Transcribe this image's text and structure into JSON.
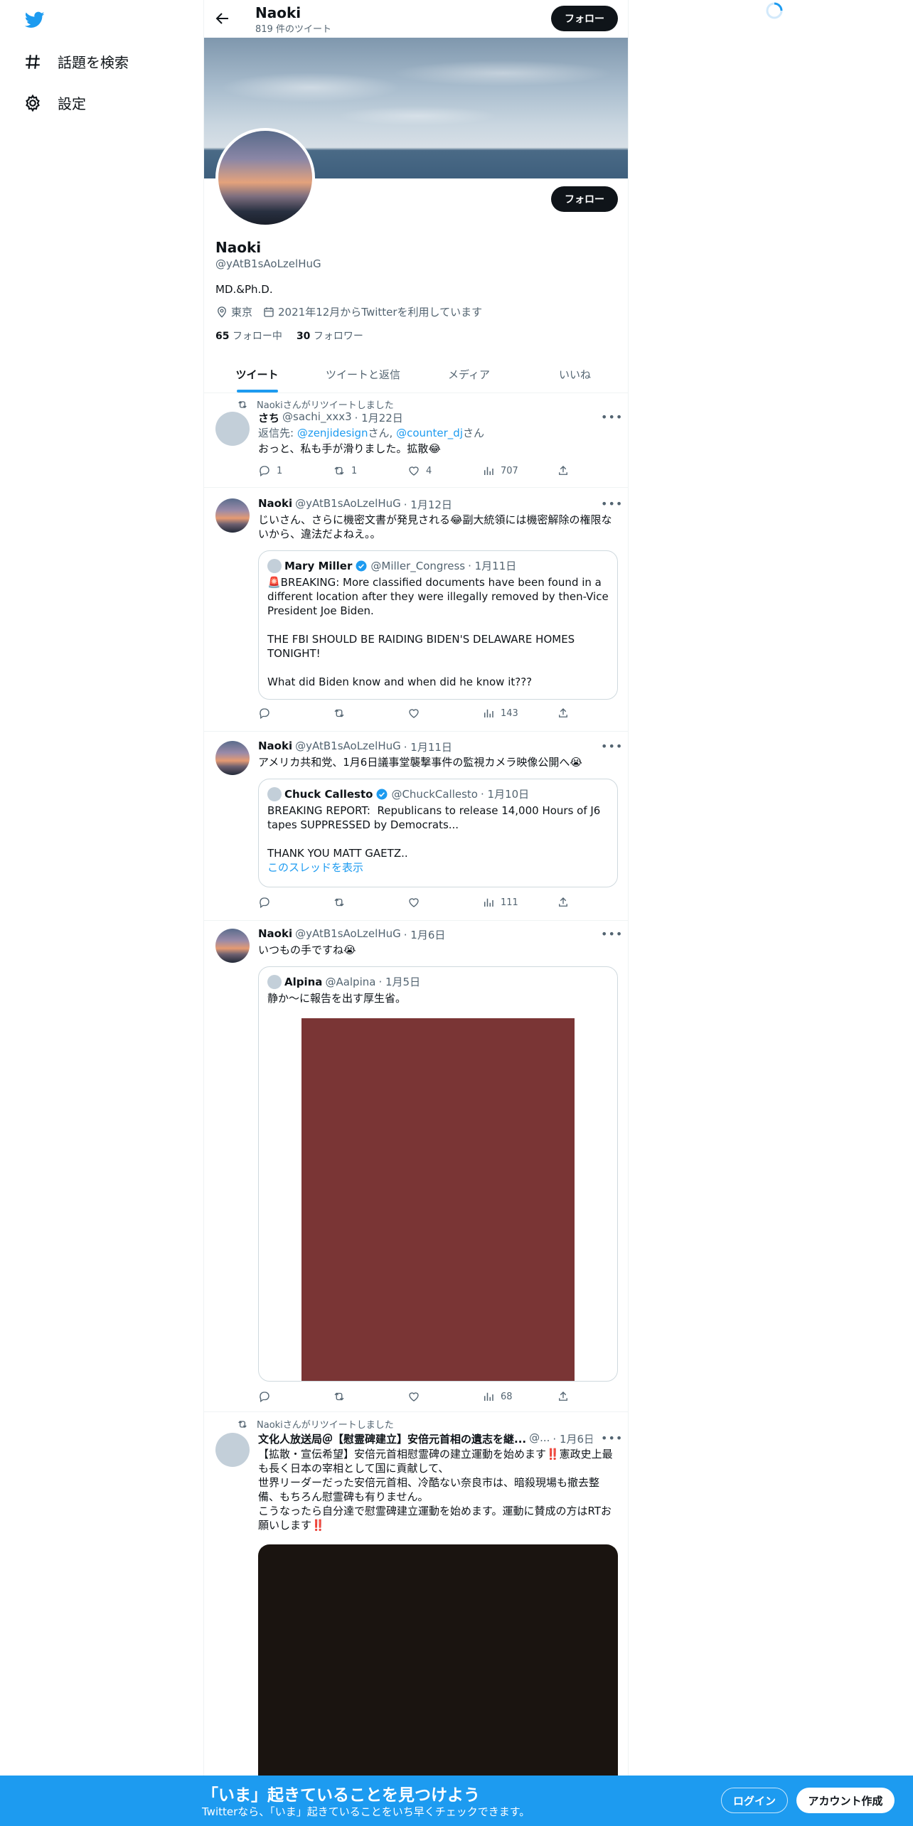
{
  "nav": {
    "logo": "twitter-bird-icon",
    "explore_label": "話題を検索",
    "settings_label": "設定"
  },
  "header": {
    "name": "Naoki",
    "tweet_count": "819 件のツイート",
    "follow_label": "フォロー"
  },
  "profile": {
    "name": "Naoki",
    "handle": "@yAtB1sAoLzelHuG",
    "bio": "MD.&Ph.D.",
    "location": "東京",
    "joined": "2021年12月からTwitterを利用しています",
    "following_count": "65",
    "following_label": "フォロー中",
    "followers_count": "30",
    "followers_label": "フォロワー",
    "follow_label": "フォロー"
  },
  "tabs": [
    {
      "label": "ツイート"
    },
    {
      "label": "ツイートと返信"
    },
    {
      "label": "メディア"
    },
    {
      "label": "いいね"
    }
  ],
  "tweets": [
    {
      "retweeted_by": "Naokiさんがリツイートしました",
      "name": "さち",
      "handle": "@sachi_xxx3",
      "date": "· 1月22日",
      "reply_prefix": "返信先: ",
      "reply_to_1": "@zenjidesign",
      "reply_sep": "さん, ",
      "reply_to_2": "@counter_dj",
      "reply_suffix": "さん",
      "text": "おっと、私も手が滑りました。拡散😂",
      "replies": "1",
      "retweets": "1",
      "likes": "4",
      "views": "707"
    },
    {
      "name": "Naoki",
      "handle": "@yAtB1sAoLzelHuG",
      "date": "· 1月12日",
      "text": "じいさん、さらに機密文書が発見される😂副大統領には機密解除の権限ないから、違法だよねえ。。",
      "quote": {
        "name": "Mary Miller",
        "handle": "@Miller_Congress",
        "date": "· 1月11日",
        "text": "🚨BREAKING: More classified documents have been found in a different location after they were illegally removed by then-Vice President Joe Biden.\n\nTHE FBI SHOULD BE RAIDING BIDEN'S DELAWARE HOMES TONIGHT!\n\nWhat did Biden know and when did he know it???"
      },
      "views": "143"
    },
    {
      "name": "Naoki",
      "handle": "@yAtB1sAoLzelHuG",
      "date": "· 1月11日",
      "text": "アメリカ共和党、1月6日議事堂襲撃事件の監視カメラ映像公開へ😭",
      "quote": {
        "name": "Chuck Callesto",
        "handle": "@ChuckCallesto",
        "date": "· 1月10日",
        "text": "BREAKING REPORT:  Republicans to release 14,000 Hours of J6 tapes SUPPRESSED by Democrats...\n\nTHANK YOU MATT GAETZ..",
        "show_thread": "このスレッドを表示"
      },
      "views": "111"
    },
    {
      "name": "Naoki",
      "handle": "@yAtB1sAoLzelHuG",
      "date": "· 1月6日",
      "text": "いつもの手ですね😭",
      "quote": {
        "name": "Alpina",
        "handle": "@Aalpina",
        "date": "· 1月5日",
        "text": "静か～に報告を出す厚生省。"
      },
      "views": "68"
    },
    {
      "retweeted_by": "Naokiさんがリツイートしました",
      "name": "文化人放送局＠【慰霊碑建立】安倍元首相の遺志を継...",
      "handle": "@...",
      "date": "· 1月6日",
      "text": "【拡散・宣伝希望】安倍元首相慰霊碑の建立運動を始めます‼️憲政史上最も長く日本の宰相として国に貢献して、\n世界リーダーだった安倍元首相、冷酷ない奈良市は、暗殺現場も撤去整備、もちろん慰霊碑も有りません。\nこうなったら自分達で慰霊碑建立運動を始めます。運動に賛成の方はRTお願いします‼️"
    }
  ],
  "bottom_bar": {
    "title": "「いま」起きていることを見つけよう",
    "subtitle": "Twitterなら、「いま」起きていることをいち早くチェックできます。",
    "login_label": "ログイン",
    "signup_label": "アカウント作成"
  },
  "colors": {
    "accent": "#1d9bf0",
    "text": "#0f1419",
    "muted": "#536471"
  }
}
